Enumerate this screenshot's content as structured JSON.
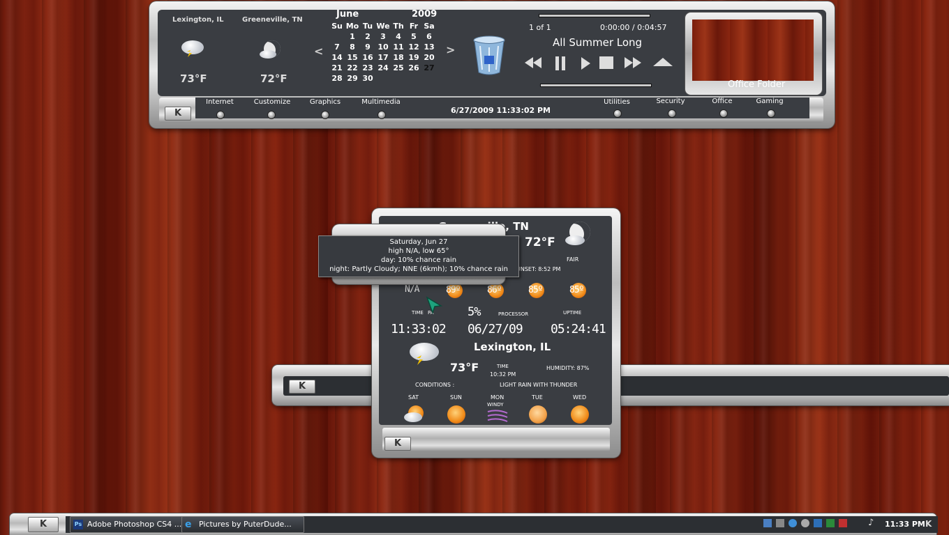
{
  "top_panel": {
    "weather": [
      {
        "city": "Lexington, IL",
        "temp": "73°F"
      },
      {
        "city": "Greeneville, TN",
        "temp": "72°F"
      }
    ],
    "calendar": {
      "month": "June",
      "year": "2009",
      "prev": "<",
      "next": ">",
      "weekdays": [
        "Su",
        "Mo",
        "Tu",
        "We",
        "Th",
        "Fr",
        "Sa"
      ],
      "weeks": [
        [
          "",
          "1",
          "2",
          "3",
          "4",
          "5",
          "6"
        ],
        [
          "7",
          "8",
          "9",
          "10",
          "11",
          "12",
          "13"
        ],
        [
          "14",
          "15",
          "16",
          "17",
          "18",
          "19",
          "20"
        ],
        [
          "21",
          "22",
          "23",
          "24",
          "25",
          "26",
          "27"
        ],
        [
          "28",
          "29",
          "30",
          "",
          "",
          "",
          ""
        ]
      ]
    },
    "media": {
      "track_index": "1 of 1",
      "time": "0:00:00 / 0:04:57",
      "title": "All Summer Long",
      "controls": [
        "rewind-icon",
        "pause-icon",
        "play-icon",
        "stop-icon",
        "fast-forward-icon",
        "eject-icon"
      ]
    },
    "folder_label": "Office Folder",
    "k_button": "K",
    "nav_left": [
      "Internet",
      "Customize",
      "Graphics",
      "Multimedia"
    ],
    "nav_right": [
      "Utilities",
      "Security",
      "Office",
      "Gaming"
    ],
    "datetime": "6/27/2009 11:33:02 PM"
  },
  "widget": {
    "city_top": "Greeneville, TN",
    "temp_top": "72°F",
    "condition_top": "FAIR",
    "sunset": "UNSET: 8:52 PM",
    "forecast_temps": [
      "N/A",
      "89º",
      "86º",
      "85º",
      "85º"
    ],
    "labels": {
      "time": "TIME",
      "processor": "PROCESSOR",
      "uptime": "UPTIME",
      "time_pa": "PA"
    },
    "cpu": "5%",
    "clock": "11:33:02",
    "date": "06/27/09",
    "uptime": "05:24:41",
    "city_bottom": "Lexington, IL",
    "temp_bottom": "73°F",
    "time_label": "TIME",
    "time_value": "10:32 PM",
    "humidity": "HUMIDITY: 87%",
    "conditions_label": "CONDITIONS :",
    "conditions_value": "LIGHT RAIN WITH THUNDER",
    "days": [
      "SAT",
      "SUN",
      "MON",
      "TUE",
      "WED"
    ],
    "windy": "WINDY",
    "k_button": "K"
  },
  "tooltip": {
    "line1": "Saturday, Jun 27",
    "line2": "high N/A, low 65°",
    "line3": "day: 10% chance rain",
    "line4": "night: Partly Cloudy; NNE (6kmh); 10% chance rain"
  },
  "middle_bar": {
    "k_button": "K"
  },
  "taskbar": {
    "start": "K",
    "tasks": [
      "Adobe Photoshop CS4 ...",
      "Pictures by PuterDude..."
    ],
    "clock": "11:33 PM",
    "end_k": "K"
  }
}
